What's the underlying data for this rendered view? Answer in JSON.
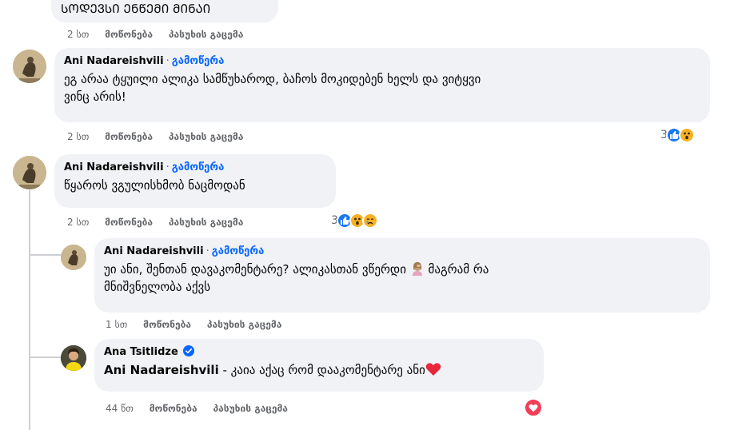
{
  "comments": [
    {
      "id": "c0",
      "text": "ᲡᲝᲓᲔᲕᲡᲘ ᲔᲜᲬᲔᲛᲘ ᲛᲘᲜᲐᲘ",
      "time": "2 სთ",
      "like_label": "მოწონება",
      "reply_label": "პასუხის გაცემა"
    },
    {
      "id": "c1",
      "author": "Ani Nadareishvili",
      "separator": "·",
      "follow_label": "გამოწერა",
      "text": "ეგ არაა ტყუილი ალიკა სამწუხაროდ, ბაჩოს მოკიდებენ ხელს და ვიტყვი\nვინც არის!",
      "time": "2 სთ",
      "like_label": "მოწონება",
      "reply_label": "პასუხის გაცემა",
      "reaction_count": "3",
      "reactions": [
        "like-icon",
        "wow-icon"
      ]
    },
    {
      "id": "c2",
      "author": "Ani Nadareishvili",
      "separator": "·",
      "follow_label": "გამოწერა",
      "text": "წყაროს ვგულისხმობ ნაცმოდან",
      "time": "2 სთ",
      "like_label": "მოწონება",
      "reply_label": "პასუხის გაცემა",
      "reaction_count": "3",
      "reactions": [
        "like-icon",
        "wow-icon",
        "sad-icon"
      ]
    }
  ],
  "replies": [
    {
      "id": "r1",
      "author": "Ani Nadareishvili",
      "separator": "·",
      "follow_label": "გამოწერა",
      "text": "უი ანი, შენთან დავაკომენტარე? ალიკასთან ვწერდი",
      "text_tail": "მაგრამ რა\nმნიშვნელობა აქვს",
      "emoji": "woman-facepalming",
      "time": "1 სთ",
      "like_label": "მოწონება",
      "reply_label": "პასუხის გაცემა"
    },
    {
      "id": "r2",
      "author": "Ana Tsitlidze",
      "verified": true,
      "mention": "Ani Nadareishvili",
      "text": " - კაია აქაც რომ დააკომენტარე ანი",
      "time": "44 წთ",
      "like_label": "მოწონება",
      "reply_label": "პასუხის გაცემა",
      "reactions": [
        "love-icon"
      ]
    }
  ],
  "colors": {
    "bubble": "#f0f2f5",
    "link_blue": "#0866ff",
    "meta_gray": "#65676b",
    "like_blue": "#1877f2",
    "love_red": "#f33e58",
    "wow_yellow": "#f7b125"
  }
}
